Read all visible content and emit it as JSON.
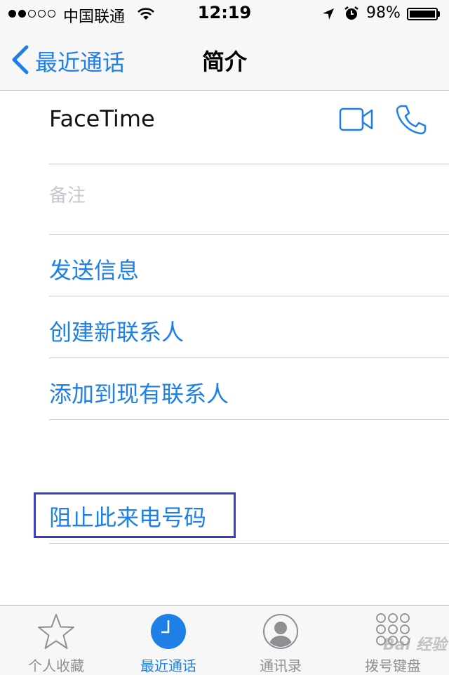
{
  "status_bar": {
    "carrier": "中国联通",
    "time": "12:19",
    "battery": "98%",
    "signal_bars_filled": 2,
    "signal_bars_total": 5
  },
  "nav": {
    "back_label": "最近通话",
    "title": "简介"
  },
  "facetime": {
    "label": "FaceTime"
  },
  "notes": {
    "placeholder": "备注"
  },
  "actions": [
    {
      "label": "发送信息"
    },
    {
      "label": "创建新联系人"
    },
    {
      "label": "添加到现有联系人"
    }
  ],
  "block": {
    "label": "阻止此来电号码"
  },
  "tabs": [
    {
      "label": "个人收藏",
      "icon": "star-icon",
      "active": false
    },
    {
      "label": "最近通话",
      "icon": "clock-icon",
      "active": true
    },
    {
      "label": "通讯录",
      "icon": "contact-icon",
      "active": false
    },
    {
      "label": "拨号键盘",
      "icon": "keypad-icon",
      "active": false
    }
  ],
  "watermark": "Bai 经验",
  "colors": {
    "accent": "#1e7fe6",
    "highlight_box": "#3c3ec2",
    "separator": "#c8c7cc"
  }
}
